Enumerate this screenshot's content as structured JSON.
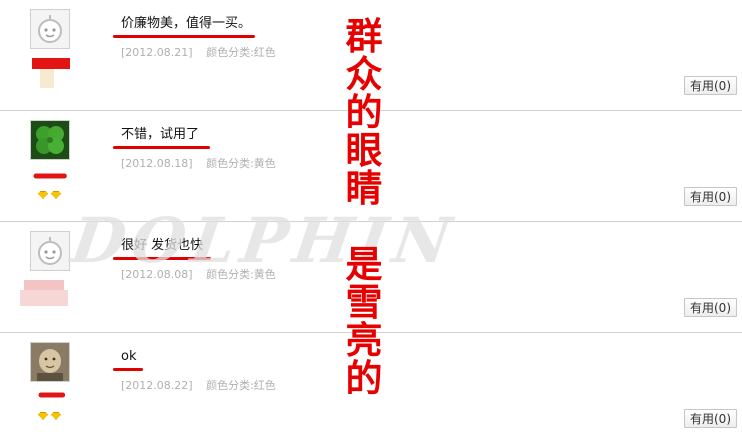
{
  "reviews": [
    {
      "comment": "价廉物美，值得一买。",
      "date": "[2012.08.21]",
      "attribute": "颜色分类:红色",
      "useful_label": "有用(0)",
      "avatar": "default-avatar",
      "level_icons": 0
    },
    {
      "comment": "不错，试用了",
      "date": "[2012.08.18]",
      "attribute": "颜色分类:黄色",
      "useful_label": "有用(0)",
      "avatar": "clover-avatar",
      "level_icons": 2
    },
    {
      "comment": "很好 发货也快",
      "date": "[2012.08.08]",
      "attribute": "颜色分类:黄色",
      "useful_label": "有用(0)",
      "avatar": "default-avatar",
      "level_icons": 0
    },
    {
      "comment": "ok",
      "date": "[2012.08.22]",
      "attribute": "颜色分类:红色",
      "useful_label": "有用(0)",
      "avatar": "baby-photo-avatar",
      "level_icons": 2
    }
  ],
  "annotation": {
    "line1": "群众的眼睛",
    "line2": "是雪亮的",
    "color": "#e60000"
  },
  "watermark": "DOLPHIN",
  "colors": {
    "underline": "#e00000",
    "meta_text": "#b0b0b0",
    "divider": "#d2d2d2"
  }
}
